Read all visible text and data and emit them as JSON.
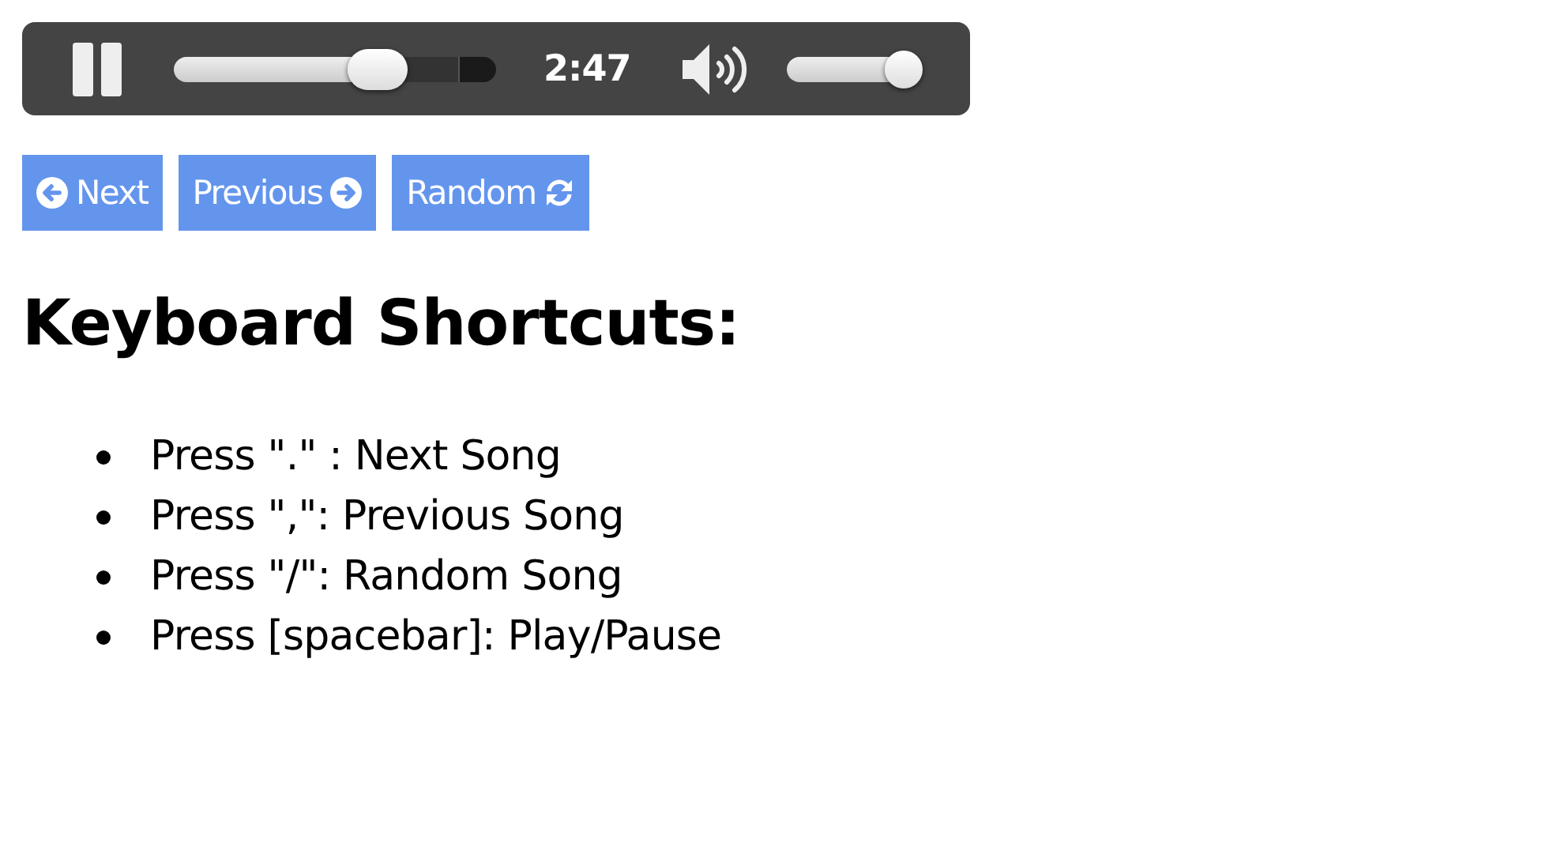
{
  "player": {
    "playing": true,
    "seek": {
      "level": 0.63
    },
    "buffered": {
      "level": 0.88
    },
    "time": "2:47",
    "volume": {
      "level": 0.86
    }
  },
  "buttons": [
    {
      "label": "Next",
      "kind": "prev-arrow"
    },
    {
      "label": "Previous",
      "kind": "next-arrow"
    },
    {
      "label": "Random",
      "kind": "shuffle"
    }
  ],
  "heading": "Keyboard Shortcuts:",
  "shortcuts": [
    "Press \".\" : Next Song",
    "Press \",\": Previous Song",
    "Press \"/\": Random Song",
    "Press [spacebar]: Play/Pause"
  ]
}
